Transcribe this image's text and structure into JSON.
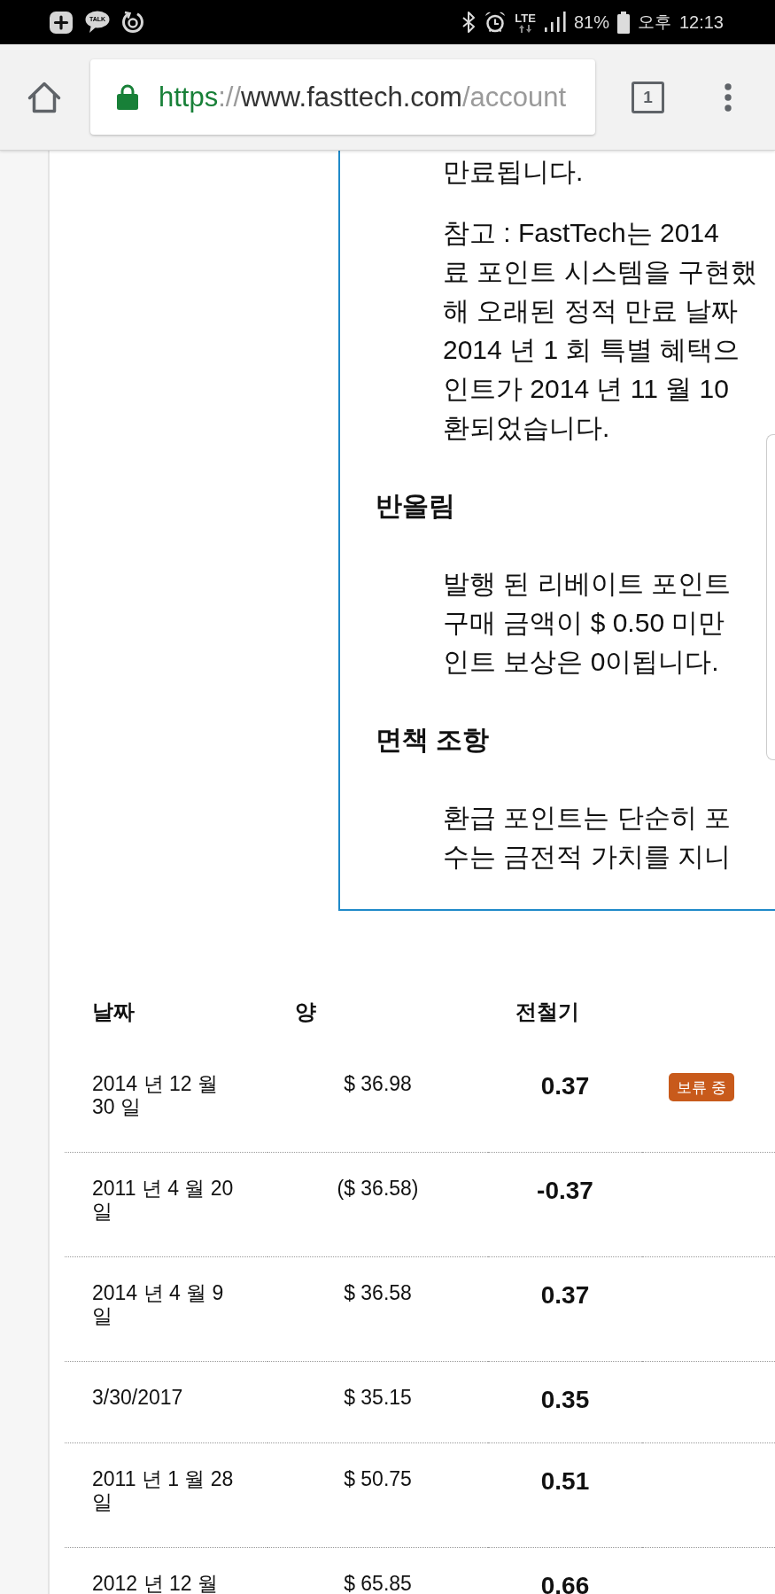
{
  "status_bar": {
    "notification_icons": [
      {
        "kind": "plus_badge"
      },
      {
        "kind": "talk",
        "label": "TALK"
      },
      {
        "kind": "sync"
      }
    ],
    "network": "LTE",
    "battery": "81%",
    "meridiem": "오후",
    "time": "12:13"
  },
  "browser_toolbar": {
    "url": {
      "scheme": "https",
      "separator": "://",
      "host": "www.fasttech.com",
      "path": "/account"
    },
    "tab_count": "1"
  },
  "info_panel": {
    "blocks": [
      {
        "kind": "paragraph",
        "lines": [
          "만료됩니다."
        ]
      },
      {
        "kind": "paragraph",
        "lines": [
          "참고 : FastTech는 2014",
          "료 포인트 시스템을 구현했",
          "해 오래된 정적 만료 날짜",
          "2014 년 1 회 특별 혜택으",
          "인트가 2014 년 11 월 10",
          "환되었습니다."
        ]
      },
      {
        "kind": "heading",
        "text": "반올림"
      },
      {
        "kind": "paragraph",
        "lines": [
          "발행 된 리베이트 포인트",
          "구매 금액이 $ 0.50 미만",
          "인트 보상은 0이됩니다."
        ]
      },
      {
        "kind": "heading",
        "text": "면책 조항"
      },
      {
        "kind": "paragraph",
        "lines": [
          "환급 포인트는 단순히 포",
          "수는 금전적 가치를 지니"
        ]
      }
    ]
  },
  "table": {
    "columns": [
      "날짜",
      "양",
      "전철기"
    ],
    "rows": [
      {
        "date": "2014 년 12 월 30 일",
        "amount": "$ 36.98",
        "points": "0.37",
        "status": "보류 중"
      },
      {
        "date": "2011 년 4 월 20 일",
        "amount": "($ 36.58)",
        "points": "-0.37"
      },
      {
        "date": "2014 년 4 월 9 일",
        "amount": "$ 36.58",
        "points": "0.37"
      },
      {
        "date": "3/30/2017",
        "amount": "$ 35.15",
        "points": "0.35"
      },
      {
        "date": "2011 년 1 월 28 일",
        "amount": "$ 50.75",
        "points": "0.51"
      },
      {
        "date": "2012 년 12 월",
        "amount": "$ 65.85",
        "points": "0.66"
      }
    ]
  }
}
